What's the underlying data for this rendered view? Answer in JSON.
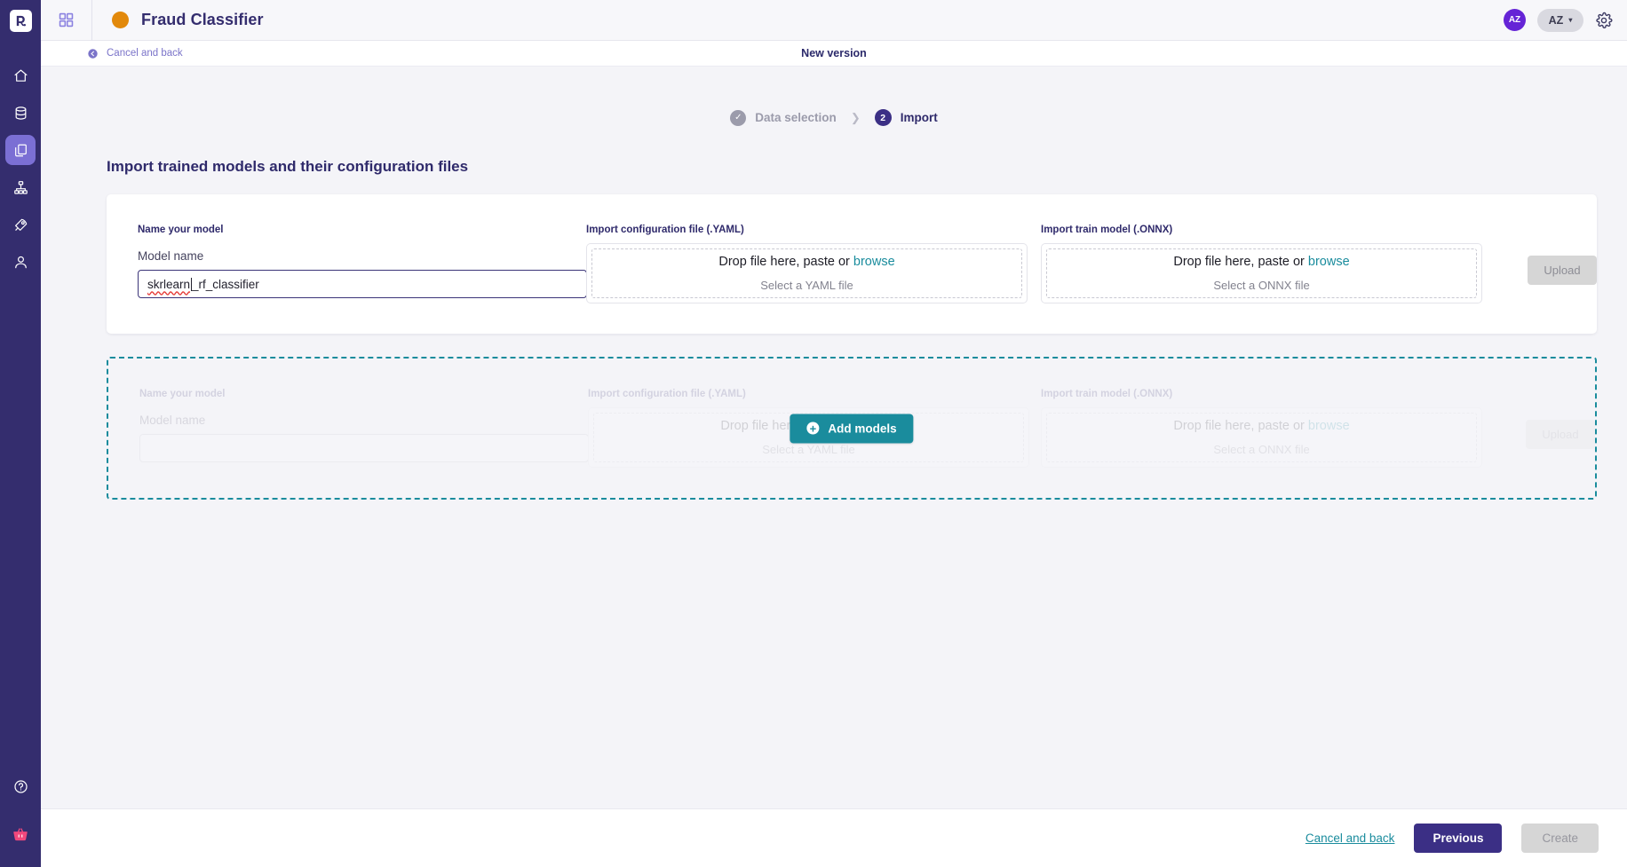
{
  "rail": {
    "logo_name": "dataiku-logo",
    "items": [
      {
        "name": "home-icon",
        "label": "Home"
      },
      {
        "name": "database-icon",
        "label": "Data"
      },
      {
        "name": "documents-icon",
        "label": "Models",
        "active": true
      },
      {
        "name": "sitemap-icon",
        "label": "Flow"
      },
      {
        "name": "rocket-icon",
        "label": "Deploy"
      },
      {
        "name": "user-icon",
        "label": "Account"
      }
    ],
    "bottom": [
      {
        "name": "help-icon",
        "label": "Help"
      },
      {
        "name": "basket-icon",
        "label": "Basket"
      }
    ]
  },
  "topbar": {
    "grid_icon": "grid-icon",
    "project_title": "Fraud Classifier",
    "project_dot_color": "#e2890b",
    "avatar_initials": "AZ",
    "user_pill_label": "AZ",
    "caret": "▾",
    "gear_icon": "gear-icon"
  },
  "subbar": {
    "cancel_label": "Cancel and back",
    "title": "New version"
  },
  "stepper": {
    "steps": [
      {
        "label": "Data selection",
        "state": "done",
        "marker": "✓"
      },
      {
        "label": "Import",
        "state": "current",
        "marker": "2"
      }
    ],
    "separator": "❯"
  },
  "page": {
    "title": "Import trained models and their configuration files"
  },
  "model_row": {
    "name_heading": "Name your model",
    "name_sublabel": "Model name",
    "name_value_misspelled": "skrlearn",
    "name_value_rest": "_rf_classifier",
    "yaml_heading": "Import configuration file (.YAML)",
    "yaml_drop_prefix": "Drop file here, paste or ",
    "yaml_drop_browse": "browse",
    "yaml_drop_sub": "Select a YAML file",
    "onnx_heading": "Import train model (.ONNX)",
    "onnx_drop_prefix": "Drop file here, paste or ",
    "onnx_drop_browse": "browse",
    "onnx_drop_sub": "Select a ONNX file",
    "upload_label": "Upload"
  },
  "ghost_row": {
    "name_heading": "Name your model",
    "name_sublabel": "Model name",
    "yaml_heading": "Import configuration file (.YAML)",
    "yaml_drop_prefix": "Drop file here, paste or ",
    "yaml_drop_browse": "browse",
    "yaml_drop_sub": "Select a YAML file",
    "onnx_heading": "Import train model (.ONNX)",
    "onnx_drop_prefix": "Drop file here, paste or ",
    "onnx_drop_browse": "browse",
    "onnx_drop_sub": "Select a ONNX file",
    "upload_label": "Upload",
    "add_models_label": "Add models",
    "add_models_icon": "plus-circle-icon"
  },
  "footer": {
    "cancel_label": "Cancel and back",
    "previous_label": "Previous",
    "create_label": "Create"
  },
  "colors": {
    "rail_bg": "#342d6e",
    "accent_purple": "#3b2f85",
    "accent_teal": "#1a8c9d",
    "project_orange": "#e2890b"
  }
}
